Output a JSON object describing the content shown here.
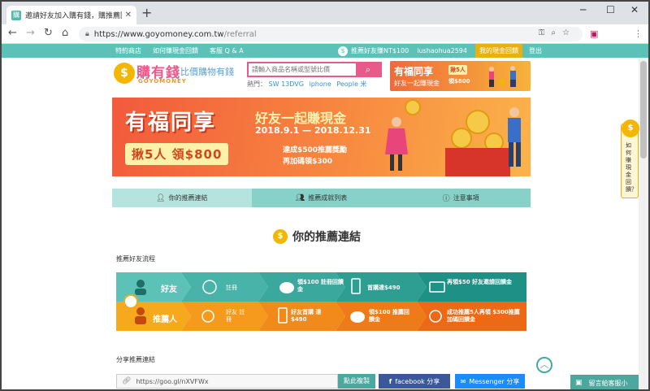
{
  "browser": {
    "tab_title": "邀請好友加入購有錢，購推薦回饋現金！",
    "url_host": "https://www.goyomoney.com.tw",
    "url_path": "/referral"
  },
  "site_bar": {
    "links": [
      "特約商店",
      "如何賺現金回饋",
      "客服 Q & A"
    ],
    "referral_text": "推薦好友賺NT$100",
    "username": "lushaohua2594",
    "wallet": "我的現金回饋",
    "logout": "登出"
  },
  "header": {
    "logo_main": "購有錢",
    "logo_sub": "GOYOMONEY",
    "slogan": "比價購物有錢",
    "search_placeholder": "請輸入商品名稱或型號比價",
    "hot_label": "熱門：",
    "hot_items": [
      "SW 13DVG",
      "iphone",
      "People 米"
    ]
  },
  "mini_banner": {
    "title": "有福同享",
    "subtitle": "好友一起賺現金",
    "badge": "揪5人",
    "amount": "領$800"
  },
  "banner": {
    "title": "有福同享",
    "subtitle": "好友一起賺現金",
    "dates": "2018.9.1 — 2018.12.31",
    "badge": "揪5人 領$800",
    "info1": "達成$500推薦獎勵",
    "info2": "再加碼領$300"
  },
  "tabs": [
    {
      "label": "你的推薦連結",
      "icon": "user-icon"
    },
    {
      "label": "推薦成就列表",
      "icon": "users-icon"
    },
    {
      "label": "注意事項",
      "icon": "info-icon"
    }
  ],
  "section_title": "你的推薦連結",
  "flow": {
    "label": "推薦好友流程",
    "row1": {
      "actor": "好友",
      "steps": [
        "註冊",
        "領$100 註冊回饋金",
        "首購達$490",
        "再領$50 好友邀請回饋金"
      ]
    },
    "row2": {
      "actor": "推薦人",
      "steps": [
        "好友 註冊",
        "好友首購 達$490",
        "領$100 推薦回饋金",
        "成功推薦5人再領 $300推薦加碼回饋金"
      ]
    }
  },
  "share": {
    "label": "分享推薦連結",
    "url": "https://goo.gl/nXVFWx",
    "copy": "點此複製",
    "facebook": "facebook 分享",
    "messenger": "Messenger 分享"
  },
  "side_widget": "如何賺現金回饋？",
  "chat": "留言給客服小",
  "colors": {
    "teal": "#5cc2b8",
    "pink": "#e85a8a",
    "gold": "#f2b705",
    "orange": "#f06a3b"
  }
}
